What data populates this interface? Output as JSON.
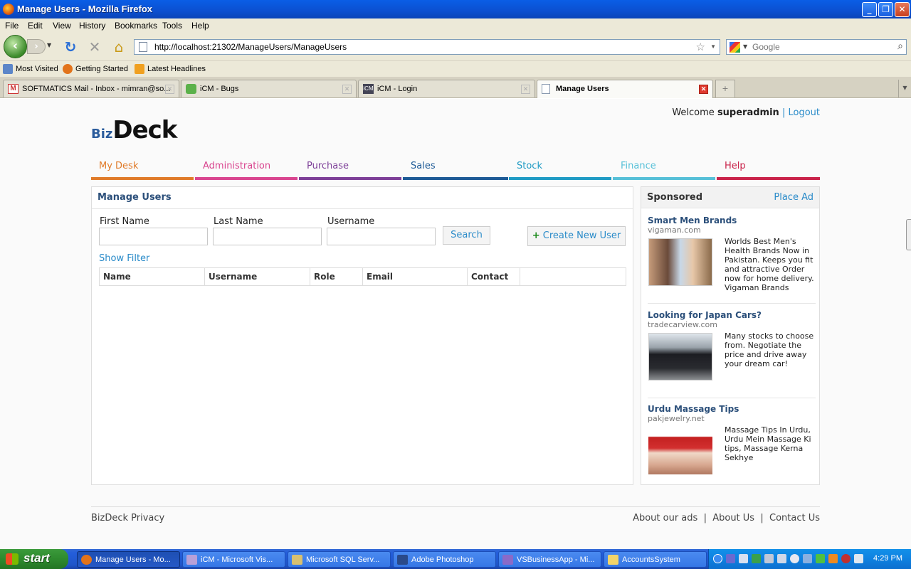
{
  "window": {
    "title": "Manage Users - Mozilla Firefox"
  },
  "menu": [
    "File",
    "Edit",
    "View",
    "History",
    "Bookmarks",
    "Tools",
    "Help"
  ],
  "url": "http://localhost:21302/ManageUsers/ManageUsers",
  "search_placeholder": "Google",
  "bookmarks": [
    "Most Visited",
    "Getting Started",
    "Latest Headlines"
  ],
  "tabs": [
    {
      "label": "SOFTMATICS Mail - Inbox - mimran@so...",
      "active": false
    },
    {
      "label": "iCM - Bugs",
      "active": false
    },
    {
      "label": "iCM - Login",
      "active": false
    },
    {
      "label": "Manage Users",
      "active": true
    }
  ],
  "header": {
    "welcome": "Welcome",
    "user": "superadmin",
    "sep": "|",
    "logout": "Logout"
  },
  "logo": {
    "prefix": "Biz",
    "main": "Deck"
  },
  "nav": [
    {
      "label": "My Desk",
      "color": "#e07b2a"
    },
    {
      "label": "Administration",
      "color": "#d9458f"
    },
    {
      "label": "Purchase",
      "color": "#7d3f98"
    },
    {
      "label": "Sales",
      "color": "#1d5a96"
    },
    {
      "label": "Stock",
      "color": "#1f9bc4"
    },
    {
      "label": "Finance",
      "color": "#56c0d8"
    },
    {
      "label": "Help",
      "color": "#c9234a"
    }
  ],
  "main": {
    "title": "Manage Users",
    "filters": {
      "first_name": "First Name",
      "last_name": "Last Name",
      "username": "Username"
    },
    "search_label": "Search",
    "create_label": "Create New User",
    "show_filter": "Show Filter",
    "columns": [
      "Name",
      "Username",
      "Role",
      "Email",
      "Contact",
      ""
    ]
  },
  "sidebar": {
    "title": "Sponsored",
    "place_ad": "Place Ad",
    "ads": [
      {
        "title": "Smart Men Brands",
        "domain": "vigaman.com",
        "text": "Worlds Best Men's Health Brands Now in Pakistan. Keeps you fit and attractive Order now for home delivery. Vigaman Brands"
      },
      {
        "title": "Looking for Japan Cars?",
        "domain": "tradecarview.com",
        "text": "Many stocks to choose from. Negotiate the price and drive away your dream car!"
      },
      {
        "title": "Urdu Massage Tips",
        "domain": "pakjewelry.net",
        "text": "Massage Tips In Urdu, Urdu Mein Massage Ki tips, Massage Kerna Sekhye"
      }
    ]
  },
  "footer": {
    "privacy": "BizDeck Privacy",
    "links": [
      "About our ads",
      "About Us",
      "Contact Us"
    ],
    "sep": "|"
  },
  "taskbar": {
    "start": "start",
    "items": [
      "Manage Users - Mo...",
      "iCM - Microsoft Vis...",
      "Microsoft SQL Serv...",
      "Adobe Photoshop",
      "VSBusinessApp - Mi...",
      "AccountsSystem"
    ],
    "clock": "4:29 PM"
  }
}
